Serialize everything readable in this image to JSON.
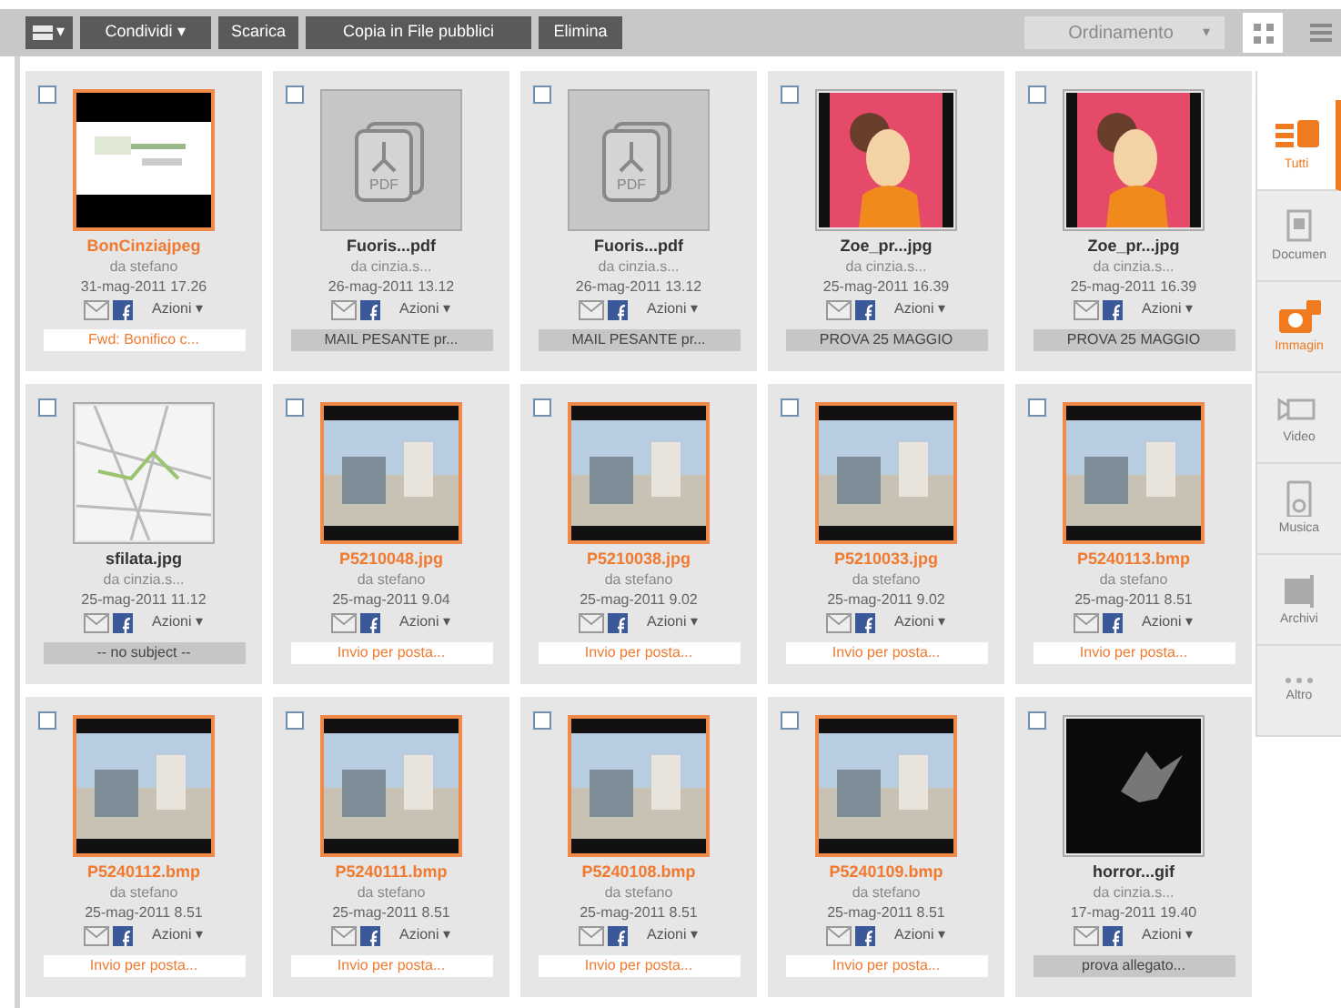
{
  "toolbar": {
    "view_menu": {
      "caret": "▾"
    },
    "buttons": [
      {
        "label": "Condividi",
        "caret": "▾"
      },
      {
        "label": "Scarica"
      },
      {
        "label": "Copia in File pubblici"
      },
      {
        "label": "Elimina"
      }
    ],
    "sort": {
      "label": "Ordinamento",
      "caret": "▾",
      "disabled": true
    },
    "views": [
      {
        "kind": "grid",
        "selected": true
      },
      {
        "kind": "list",
        "selected": false
      }
    ]
  },
  "files": [
    {
      "name": "BonCinziajpeg",
      "highlighted": true,
      "kind": "scan",
      "checked": false,
      "sender": "da stefano",
      "date": "31-mag-2011 17.26",
      "actions": "Azioni",
      "actions_caret": "▾",
      "subject": "Fwd: Bonifico c..."
    },
    {
      "name": "Fuoris...pdf",
      "highlighted": false,
      "kind": "pdf",
      "badge": "PDF",
      "checked": false,
      "sender": "da cinzia.s...",
      "date": "26-mag-2011 13.12",
      "actions": "Azioni",
      "actions_caret": "▾",
      "subject": "MAIL PESANTE pr..."
    },
    {
      "name": "Fuoris...pdf",
      "highlighted": false,
      "kind": "pdf",
      "badge": "PDF",
      "checked": false,
      "sender": "da cinzia.s...",
      "date": "26-mag-2011 13.12",
      "actions": "Azioni",
      "actions_caret": "▾",
      "subject": "MAIL PESANTE pr..."
    },
    {
      "name": "Zoe_pr...jpg",
      "highlighted": false,
      "kind": "illustration",
      "checked": false,
      "sender": "da cinzia.s...",
      "date": "25-mag-2011 16.39",
      "actions": "Azioni",
      "actions_caret": "▾",
      "subject": "PROVA 25 MAGGIO"
    },
    {
      "name": "Zoe_pr...jpg",
      "highlighted": false,
      "kind": "illustration",
      "checked": false,
      "sender": "da cinzia.s...",
      "date": "25-mag-2011 16.39",
      "actions": "Azioni",
      "actions_caret": "▾",
      "subject": "PROVA 25 MAGGIO"
    },
    {
      "name": "sfilata.jpg",
      "highlighted": false,
      "kind": "map",
      "checked": false,
      "sender": "da cinzia.s...",
      "date": "25-mag-2011 11.12",
      "actions": "Azioni",
      "actions_caret": "▾",
      "subject": "-- no subject --"
    },
    {
      "name": "P5210048.jpg",
      "highlighted": true,
      "kind": "photo",
      "checked": false,
      "sender": "da stefano",
      "date": "25-mag-2011 9.04",
      "actions": "Azioni",
      "actions_caret": "▾",
      "subject": "Invio per posta..."
    },
    {
      "name": "P5210038.jpg",
      "highlighted": true,
      "kind": "photo",
      "checked": false,
      "sender": "da stefano",
      "date": "25-mag-2011 9.02",
      "actions": "Azioni",
      "actions_caret": "▾",
      "subject": "Invio per posta..."
    },
    {
      "name": "P5210033.jpg",
      "highlighted": true,
      "kind": "photo",
      "checked": false,
      "sender": "da stefano",
      "date": "25-mag-2011 9.02",
      "actions": "Azioni",
      "actions_caret": "▾",
      "subject": "Invio per posta..."
    },
    {
      "name": "P5240113.bmp",
      "highlighted": true,
      "kind": "photo",
      "checked": false,
      "sender": "da stefano",
      "date": "25-mag-2011 8.51",
      "actions": "Azioni",
      "actions_caret": "▾",
      "subject": "Invio per posta..."
    },
    {
      "name": "P5240112.bmp",
      "highlighted": true,
      "kind": "photo",
      "checked": false,
      "sender": "da stefano",
      "date": "25-mag-2011 8.51",
      "actions": "Azioni",
      "actions_caret": "▾",
      "subject": "Invio per posta..."
    },
    {
      "name": "P5240111.bmp",
      "highlighted": true,
      "kind": "photo",
      "checked": false,
      "sender": "da stefano",
      "date": "25-mag-2011 8.51",
      "actions": "Azioni",
      "actions_caret": "▾",
      "subject": "Invio per posta..."
    },
    {
      "name": "P5240108.bmp",
      "highlighted": true,
      "kind": "photo",
      "checked": false,
      "sender": "da stefano",
      "date": "25-mag-2011 8.51",
      "actions": "Azioni",
      "actions_caret": "▾",
      "subject": "Invio per posta..."
    },
    {
      "name": "P5240109.bmp",
      "highlighted": true,
      "kind": "photo",
      "checked": false,
      "sender": "da stefano",
      "date": "25-mag-2011 8.51",
      "actions": "Azioni",
      "actions_caret": "▾",
      "subject": "Invio per posta..."
    },
    {
      "name": "horror...gif",
      "highlighted": false,
      "kind": "artwork",
      "checked": false,
      "sender": "da cinzia.s...",
      "date": "17-mag-2011 19.40",
      "actions": "Azioni",
      "actions_caret": "▾",
      "subject": "prova allegato..."
    }
  ],
  "categories": [
    {
      "label": "Tutti",
      "kind": "all",
      "selected": true,
      "highlighted": true
    },
    {
      "label": "Documen",
      "kind": "documents",
      "selected": false,
      "highlighted": false
    },
    {
      "label": "Immagin",
      "kind": "images",
      "selected": false,
      "highlighted": true
    },
    {
      "label": "Video",
      "kind": "video",
      "selected": false,
      "highlighted": false
    },
    {
      "label": "Musica",
      "kind": "music",
      "selected": false,
      "highlighted": false
    },
    {
      "label": "Archivi",
      "kind": "archives",
      "selected": false,
      "highlighted": false
    },
    {
      "label": "Altro",
      "kind": "other",
      "selected": false,
      "highlighted": false
    }
  ]
}
